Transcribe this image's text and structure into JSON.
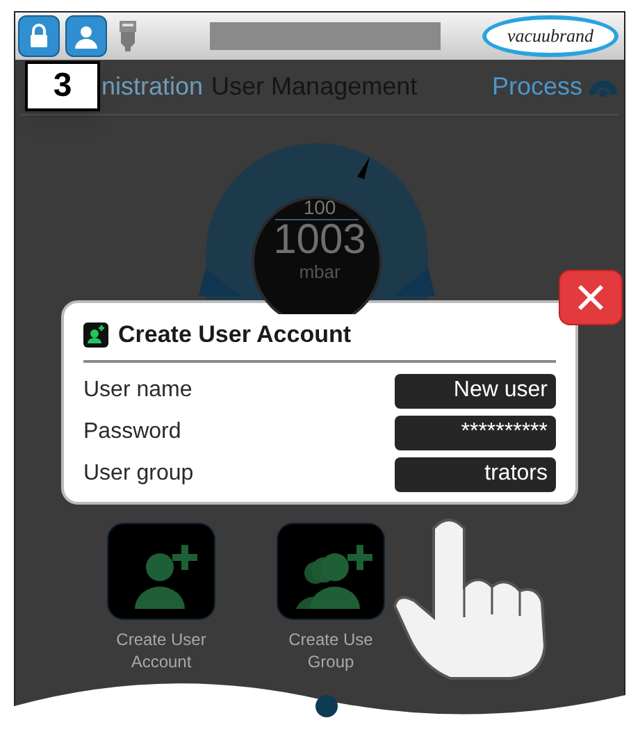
{
  "top_bar": {
    "logo": "vacuubrand"
  },
  "step_badge": "3",
  "nav": {
    "left": "nistration",
    "title": "User Management",
    "right": "Process"
  },
  "gauge": {
    "setpoint": "100",
    "reading": "1003",
    "unit": "mbar"
  },
  "dialog": {
    "title": "Create User Account",
    "fields": [
      {
        "label": "User name",
        "value": "New user"
      },
      {
        "label": "Password",
        "value": "**********"
      },
      {
        "label": "User group",
        "value": "trators"
      }
    ]
  },
  "actions": [
    {
      "kind": "user",
      "lines": [
        "Create User",
        "Account"
      ]
    },
    {
      "kind": "group",
      "lines": [
        "Create Use",
        "Group"
      ]
    }
  ]
}
